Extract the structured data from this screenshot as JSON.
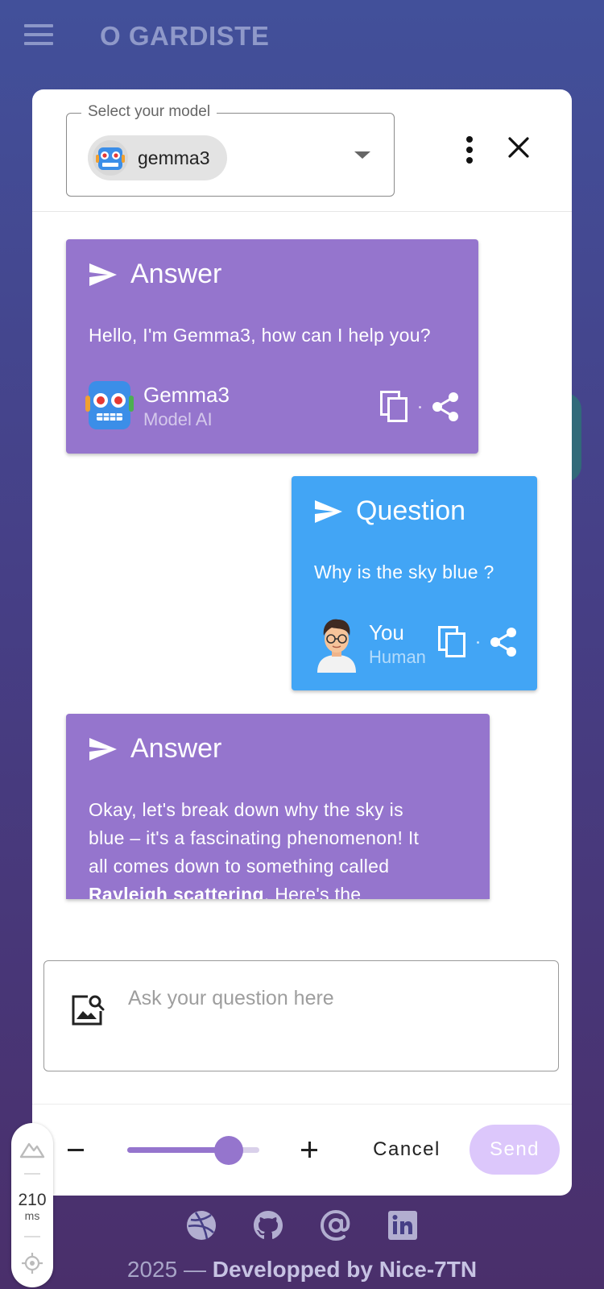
{
  "app": {
    "title": "O GARDISTE"
  },
  "dialog": {
    "model_select": {
      "label": "Select your model",
      "selected": "gemma3"
    },
    "messages": [
      {
        "kind": "answer",
        "title": "Answer",
        "text": "Hello, I'm Gemma3, how can I help you?",
        "author": "Gemma3",
        "role": "Model AI"
      },
      {
        "kind": "question",
        "title": "Question",
        "text": "Why is the sky blue ?",
        "author": "You",
        "role": "Human"
      },
      {
        "kind": "answer",
        "title": "Answer",
        "text_lines": [
          "Okay, let's break down why the sky is",
          "blue – it's a fascinating phenomenon! It",
          "all comes down to something called"
        ],
        "text_bold": "Rayleigh scattering",
        "text_after": ". Here's the"
      }
    ],
    "input": {
      "placeholder": "Ask your question here",
      "value": ""
    },
    "footer": {
      "slider_fraction": 0.77,
      "cancel_label": "Cancel",
      "send_label": "Send"
    }
  },
  "latency": {
    "value": "210",
    "unit": "ms"
  },
  "footer": {
    "year_text": "2025 — ",
    "credit": "Developped by Nice-7TN",
    "social_icons": [
      "dribbble-icon",
      "github-icon",
      "at-icon",
      "linkedin-icon"
    ]
  },
  "colors": {
    "answer": "#9575cd",
    "question": "#42a5f5",
    "send_disabled": "#dcc7fb"
  }
}
